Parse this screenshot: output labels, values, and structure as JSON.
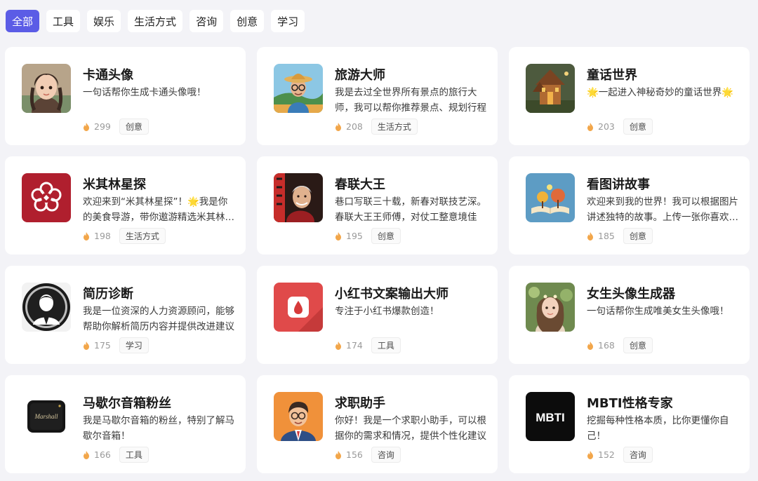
{
  "tabs": [
    {
      "label": "全部",
      "active": true
    },
    {
      "label": "工具",
      "active": false
    },
    {
      "label": "娱乐",
      "active": false
    },
    {
      "label": "生活方式",
      "active": false
    },
    {
      "label": "咨询",
      "active": false
    },
    {
      "label": "创意",
      "active": false
    },
    {
      "label": "学习",
      "active": false
    }
  ],
  "colors": {
    "accent": "#5b5ce6",
    "fire": "#f2a64a"
  },
  "cards": [
    {
      "title": "卡通头像",
      "desc": "一句话帮你生成卡通头像哦！",
      "count": "299",
      "tag": "创意",
      "icon": "cartoon-girl-avatar-icon"
    },
    {
      "title": "旅游大师",
      "desc": "我是去过全世界所有景点的旅行大师，我可以帮你推荐景点、规划行程",
      "count": "208",
      "tag": "生活方式",
      "icon": "traveler-avatar-icon"
    },
    {
      "title": "童话世界",
      "desc": "🌟一起进入神秘奇妙的童话世界🌟",
      "count": "203",
      "tag": "创意",
      "icon": "fairy-castle-icon"
    },
    {
      "title": "米其林星探",
      "desc": "欢迎来到“米其林星探”！🌟我是你的美食导游，带你遨游精选米其林餐厅",
      "count": "198",
      "tag": "生活方式",
      "icon": "michelin-flower-icon"
    },
    {
      "title": "春联大王",
      "desc": "巷口写联三十载，新春对联技艺深。春联大王王师傅，对仗工整意境佳",
      "count": "195",
      "tag": "创意",
      "icon": "calligrapher-avatar-icon"
    },
    {
      "title": "看图讲故事",
      "desc": "欢迎来到我的世界！我可以根据图片讲述独特的故事。上传一张你喜欢的图片吧",
      "count": "185",
      "tag": "创意",
      "icon": "storybook-icon"
    },
    {
      "title": "简历诊断",
      "desc": "我是一位资深的人力资源顾问，能够帮助你解析简历内容并提供改进建议",
      "count": "175",
      "tag": "学习",
      "icon": "businessman-silhouette-icon"
    },
    {
      "title": "小红书文案输出大师",
      "desc": "专注于小红书爆款创造！",
      "count": "174",
      "tag": "工具",
      "icon": "red-book-icon"
    },
    {
      "title": "女生头像生成器",
      "desc": "一句话帮你生成唯美女生头像哦！",
      "count": "168",
      "tag": "创意",
      "icon": "girl-portrait-icon"
    },
    {
      "title": "马歇尔音箱粉丝",
      "desc": "我是马歇尔音箱的粉丝，特别了解马歇尔音箱！",
      "count": "166",
      "tag": "工具",
      "icon": "speaker-icon"
    },
    {
      "title": "求职助手",
      "desc": "你好！我是一个求职小助手，可以根据你的需求和情况，提供个性化建议",
      "count": "156",
      "tag": "咨询",
      "icon": "job-seeker-avatar-icon"
    },
    {
      "title": "MBTI性格专家",
      "desc": "挖掘每种性格本质，比你更懂你自己！",
      "count": "152",
      "tag": "咨询",
      "icon": "mbti-logo-icon",
      "logo_text": "MBTI"
    }
  ],
  "speaker_logo_text": "Marshall"
}
